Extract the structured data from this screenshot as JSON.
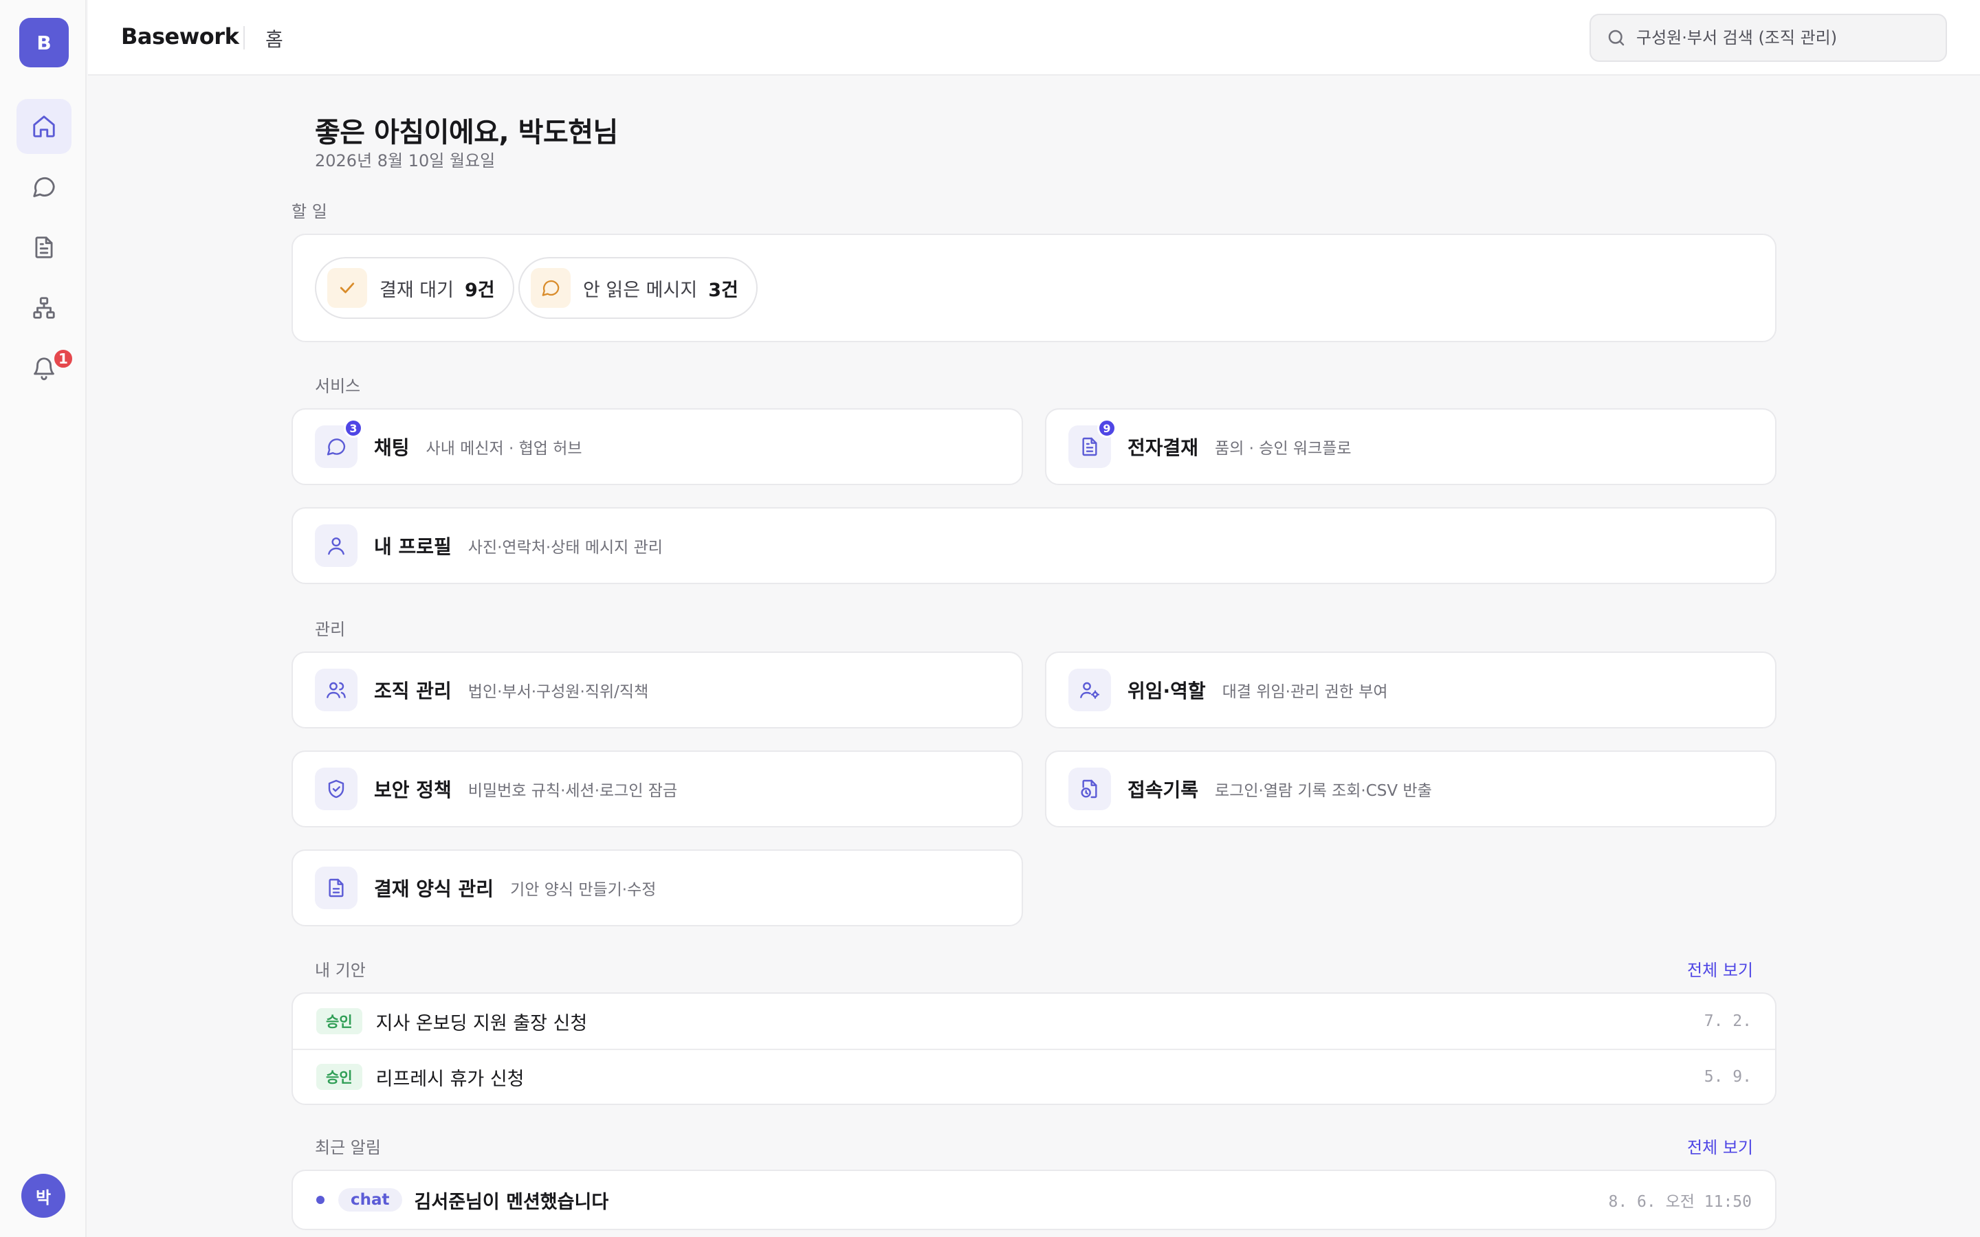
{
  "app": {
    "brand": "Basework",
    "page": "홈",
    "logo_letter": "B",
    "user_initial": "박"
  },
  "search": {
    "placeholder": "구성원·부서 검색 (조직 관리)"
  },
  "sidebar": {
    "items": [
      {
        "icon": "home-icon",
        "active": true
      },
      {
        "icon": "chat-icon"
      },
      {
        "icon": "document-icon"
      },
      {
        "icon": "org-chart-icon"
      },
      {
        "icon": "bell-icon",
        "badge": "1"
      }
    ]
  },
  "greeting": {
    "title": "좋은 아침이에요, 박도현님",
    "date": "2026년 8월 10일 월요일"
  },
  "todo": {
    "label": "할 일",
    "items": [
      {
        "label": "결재 대기",
        "count": "9건",
        "icon": "check-icon"
      },
      {
        "label": "안 읽은 메시지",
        "count": "3건",
        "icon": "chat-icon"
      }
    ]
  },
  "services": {
    "label": "서비스",
    "items": [
      {
        "title": "채팅",
        "desc": "사내 메신저 · 협업 허브",
        "badge": "3",
        "icon": "chat-icon"
      },
      {
        "title": "전자결재",
        "desc": "품의 · 승인 워크플로",
        "badge": "9",
        "icon": "document-icon"
      },
      {
        "title": "내 프로필",
        "desc": "사진·연락처·상태 메시지 관리",
        "icon": "user-icon"
      }
    ]
  },
  "admin": {
    "label": "관리",
    "items": [
      {
        "title": "조직 관리",
        "desc": "법인·부서·구성원·직위/직책",
        "icon": "users-icon"
      },
      {
        "title": "위임·역할",
        "desc": "대결 위임·관리 권한 부여",
        "icon": "user-gear-icon"
      },
      {
        "title": "보안 정책",
        "desc": "비밀번호 규칙·세션·로그인 잠금",
        "icon": "shield-check-icon"
      },
      {
        "title": "접속기록",
        "desc": "로그인·열람 기록 조회·CSV 반출",
        "icon": "file-clock-icon"
      },
      {
        "title": "결재 양식 관리",
        "desc": "기안 양식 만들기·수정",
        "icon": "form-document-icon"
      }
    ]
  },
  "my_drafts": {
    "label": "내 기안",
    "view_all": "전체 보기",
    "rows": [
      {
        "status": "승인",
        "title": "지사 온보딩 지원 출장 신청",
        "date": "7. 2."
      },
      {
        "status": "승인",
        "title": "리프레시 휴가 신청",
        "date": "5. 9."
      }
    ]
  },
  "notifications": {
    "label": "최근 알림",
    "view_all": "전체 보기",
    "rows": [
      {
        "tag": "chat",
        "title": "김서준님이 멘션했습니다",
        "time": "8. 6. 오전 11:50"
      }
    ]
  },
  "colors": {
    "accent": "#5b5bd6",
    "badge_red": "#e5484d",
    "approved_green": "#2f9e55",
    "todo_icon": "#d98c2b"
  }
}
